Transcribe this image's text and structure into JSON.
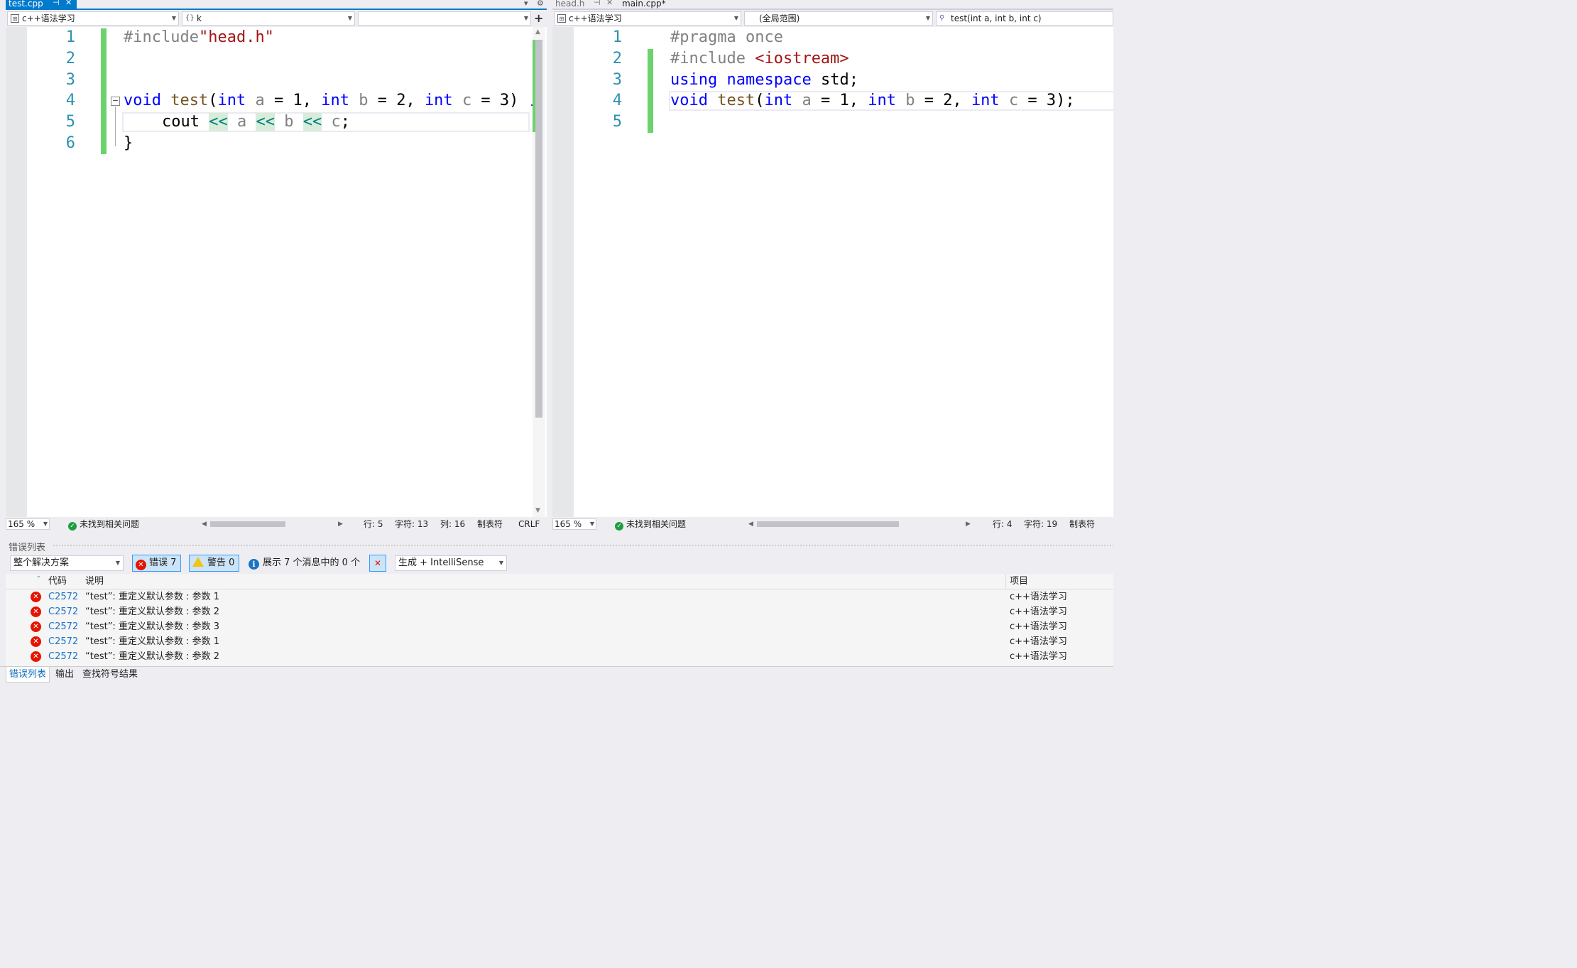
{
  "left_pane": {
    "tabs": [
      {
        "label": "test.cpp",
        "active": true,
        "pin": "⊣",
        "close": "✕"
      }
    ],
    "tab_dropdown": "▾",
    "tab_settings": "⚙",
    "nav": {
      "project": "c++语法学习",
      "scope_icon": "{}",
      "scope": "k",
      "member": ""
    },
    "split_icon": "+",
    "line_numbers": [
      "1",
      "2",
      "3",
      "4",
      "5",
      "6"
    ],
    "collapse_glyph": "−",
    "status": {
      "zoom": "165 %",
      "issues": "未找到相关问题",
      "line": "行: 5",
      "char": "字符: 13",
      "col": "列: 16",
      "tabs": "制表符",
      "eol": "CRLF"
    }
  },
  "right_pane": {
    "tabs": [
      {
        "label": "head.h",
        "active": false,
        "pin": "⊣",
        "close": "✕"
      },
      {
        "label": "main.cpp*",
        "active": false
      }
    ],
    "nav": {
      "project": "c++语法学习",
      "scope": "(全局范围)",
      "member": "test(int a, int b, int c)"
    },
    "line_numbers": [
      "1",
      "2",
      "3",
      "4",
      "5"
    ],
    "status": {
      "zoom": "165 %",
      "issues": "未找到相关问题",
      "line": "行: 4",
      "char": "字符: 19",
      "tabs": "制表符"
    }
  },
  "code_tokens": {
    "include_kw": "#include",
    "head_str": "\"head.h\"",
    "void": "void",
    "test": "test",
    "int": "int",
    "a": "a",
    "b": "b",
    "c": "c",
    "eq1": " = 1, ",
    "eq2": " = 2, ",
    "eq3": " = 3)",
    "eq3semi": " = 3);",
    "cout": "cout",
    "shl": "<<",
    "semi": ";",
    "brace": "}",
    "pragma": "#pragma once",
    "iostream": "<iostream>",
    "using": "using",
    "namespace": "namespace",
    "std": "std;",
    "paren": "("
  },
  "error_list": {
    "title": "错误列表",
    "scope_combo": "整个解决方案",
    "errors_btn": "错误 7",
    "warnings_btn": "警告 0",
    "messages": "展示 7 个消息中的 0 个",
    "build_combo": "生成 + IntelliSense",
    "columns": {
      "code": "代码",
      "desc": "说明",
      "project": "项目"
    },
    "rows": [
      {
        "code": "C2572",
        "desc": "“test”: 重定义默认参数 : 参数 1",
        "project": "c++语法学习"
      },
      {
        "code": "C2572",
        "desc": "“test”: 重定义默认参数 : 参数 2",
        "project": "c++语法学习"
      },
      {
        "code": "C2572",
        "desc": "“test”: 重定义默认参数 : 参数 3",
        "project": "c++语法学习"
      },
      {
        "code": "C2572",
        "desc": "“test”: 重定义默认参数 : 参数 1",
        "project": "c++语法学习"
      },
      {
        "code": "C2572",
        "desc": "“test”: 重定义默认参数 : 参数 2",
        "project": "c++语法学习"
      }
    ],
    "bottom_tabs": [
      "错误列表",
      "输出",
      "查找符号结果"
    ]
  },
  "colors": {
    "accent": "#007acc",
    "error": "#e51400",
    "change_bar": "#6bd36b"
  }
}
